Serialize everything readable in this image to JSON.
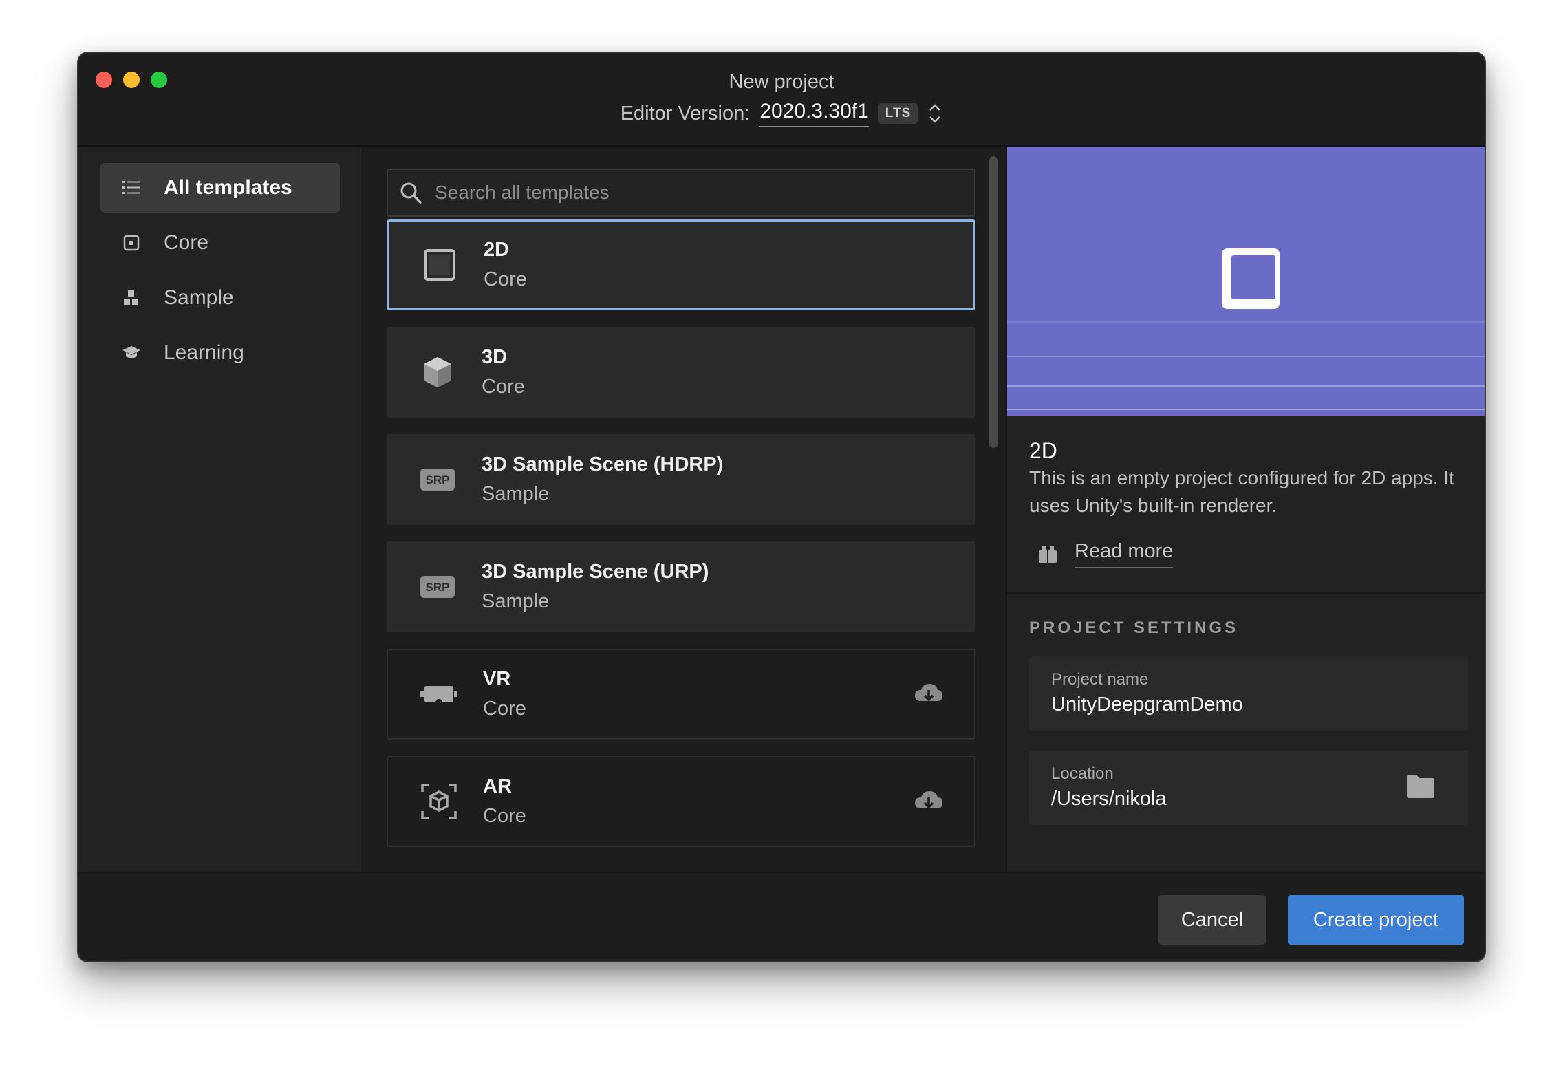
{
  "window": {
    "title": "New project",
    "editor_version_label": "Editor Version:",
    "editor_version": "2020.3.30f1",
    "lts_badge": "LTS"
  },
  "sidebar": {
    "items": [
      {
        "label": "All templates",
        "icon": "list-icon",
        "active": true
      },
      {
        "label": "Core",
        "icon": "core-icon",
        "active": false
      },
      {
        "label": "Sample",
        "icon": "sample-icon",
        "active": false
      },
      {
        "label": "Learning",
        "icon": "graduation-cap-icon",
        "active": false
      }
    ]
  },
  "search": {
    "placeholder": "Search all templates"
  },
  "templates": [
    {
      "name": "2D",
      "category": "Core",
      "icon": "square-2d-icon",
      "selected": true,
      "download": false
    },
    {
      "name": "3D",
      "category": "Core",
      "icon": "cube-3d-icon",
      "selected": false,
      "download": false
    },
    {
      "name": "3D Sample Scene (HDRP)",
      "category": "Sample",
      "icon": "srp-icon",
      "icon_text": "SRP",
      "selected": false,
      "download": false
    },
    {
      "name": "3D Sample Scene (URP)",
      "category": "Sample",
      "icon": "srp-icon",
      "icon_text": "SRP",
      "selected": false,
      "download": false
    },
    {
      "name": "VR",
      "category": "Core",
      "icon": "vr-headset-icon",
      "selected": false,
      "download": true
    },
    {
      "name": "AR",
      "category": "Core",
      "icon": "ar-cube-icon",
      "selected": false,
      "download": true
    }
  ],
  "details": {
    "title": "2D",
    "description": "This is an empty project configured for 2D apps. It uses Unity's built-in renderer.",
    "read_more": "Read more",
    "preview_color": "#6a6cc7"
  },
  "project_settings": {
    "heading": "PROJECT SETTINGS",
    "name_label": "Project name",
    "name_value": "UnityDeepgramDemo",
    "location_label": "Location",
    "location_value": "/Users/nikola"
  },
  "footer": {
    "cancel": "Cancel",
    "create": "Create project"
  },
  "colors": {
    "accent": "#3b7ed4",
    "selection_border": "#8ab3e6",
    "background": "#1d1d1d"
  }
}
